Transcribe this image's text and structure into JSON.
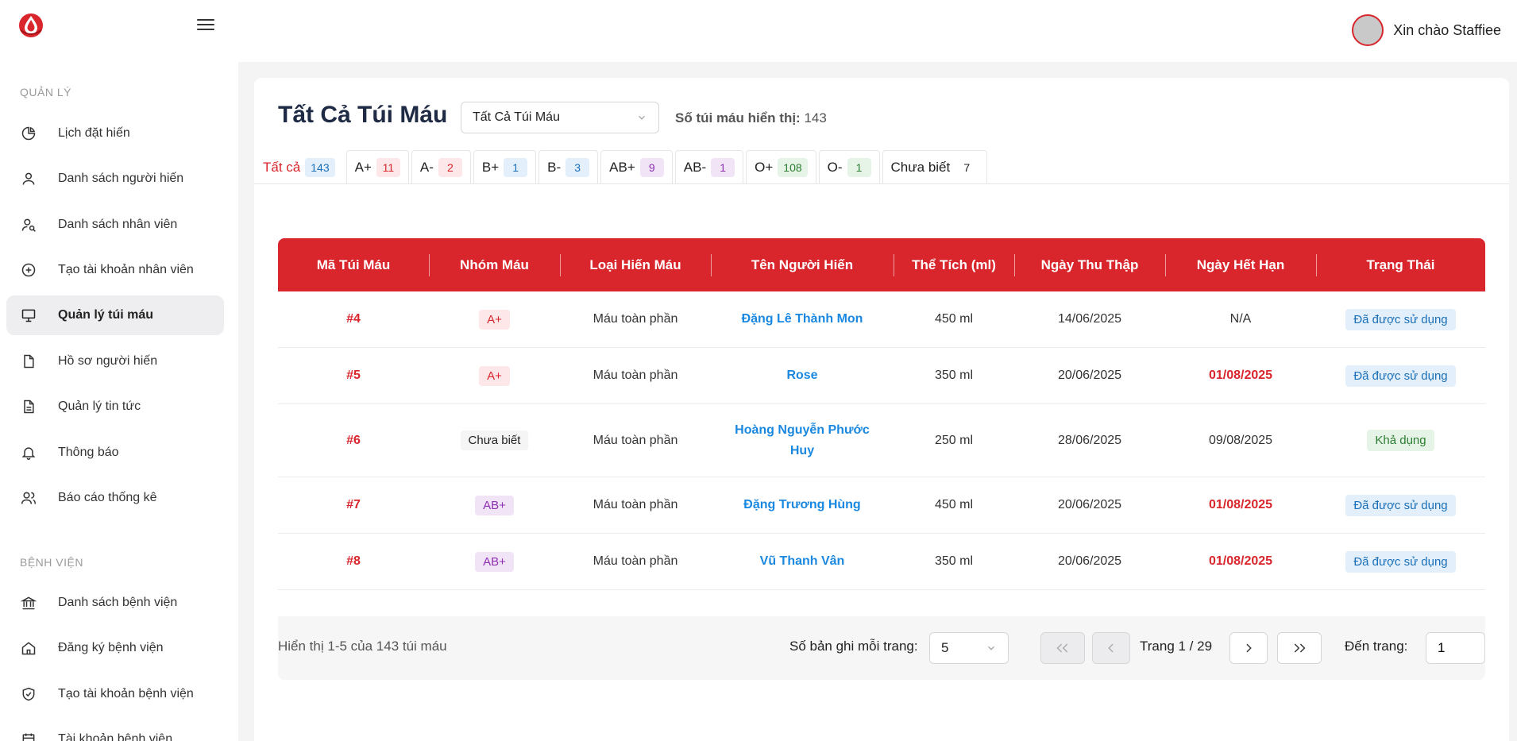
{
  "header": {
    "greeting": "Xin chào Staffiee"
  },
  "sidebar": {
    "section_manage": "QUẢN LÝ",
    "manage_items": [
      {
        "label": "Lịch đặt hiến",
        "icon": "pie-chart-icon"
      },
      {
        "label": "Danh sách người hiến",
        "icon": "user-icon"
      },
      {
        "label": "Danh sách nhân viên",
        "icon": "user-search-icon"
      },
      {
        "label": "Tạo tài khoản nhân viên",
        "icon": "plus-circle-icon"
      },
      {
        "label": "Quản lý túi máu",
        "icon": "monitor-icon",
        "active": true
      },
      {
        "label": "Hồ sơ người hiến",
        "icon": "file-icon"
      },
      {
        "label": "Quản lý tin tức",
        "icon": "file-text-icon"
      },
      {
        "label": "Thông báo",
        "icon": "bell-icon"
      },
      {
        "label": "Báo cáo thống kê",
        "icon": "users-icon"
      }
    ],
    "section_hospital": "BỆNH VIỆN",
    "hospital_items": [
      {
        "label": "Danh sách bệnh viện",
        "icon": "bank-icon"
      },
      {
        "label": "Đăng ký bệnh viện",
        "icon": "home-icon"
      },
      {
        "label": "Tạo tài khoản bệnh viện",
        "icon": "shield-check-icon"
      },
      {
        "label": "Tài khoản bệnh viện",
        "icon": "calendar-icon"
      }
    ]
  },
  "main": {
    "title": "Tất Cả Túi Máu",
    "filter_value": "Tất Cả Túi Máu",
    "count_label": "Số túi máu hiển thị:",
    "count_value": "143",
    "tabs": [
      {
        "label": "Tất cả",
        "count": "143",
        "bg": "#e3f0fb",
        "fg": "#1a6fb8"
      },
      {
        "label": "A+",
        "count": "11",
        "bg": "#fde7e8",
        "fg": "#d9262c"
      },
      {
        "label": "A-",
        "count": "2",
        "bg": "#fde7e8",
        "fg": "#d9262c"
      },
      {
        "label": "B+",
        "count": "1",
        "bg": "#e3f0fb",
        "fg": "#1a6fb8"
      },
      {
        "label": "B-",
        "count": "3",
        "bg": "#e3f0fb",
        "fg": "#1a6fb8"
      },
      {
        "label": "AB+",
        "count": "9",
        "bg": "#f1e4f7",
        "fg": "#8e2fb0"
      },
      {
        "label": "AB-",
        "count": "1",
        "bg": "#f1e4f7",
        "fg": "#8e2fb0"
      },
      {
        "label": "O+",
        "count": "108",
        "bg": "#e5f4e6",
        "fg": "#2e7d32"
      },
      {
        "label": "O-",
        "count": "1",
        "bg": "#e5f4e6",
        "fg": "#2e7d32"
      },
      {
        "label": "Chưa biết",
        "count": "7",
        "bg": "#ffffff",
        "fg": "#222222"
      }
    ],
    "table": {
      "headers": [
        "Mã Túi Máu",
        "Nhóm Máu",
        "Loại Hiến Máu",
        "Tên Người Hiến",
        "Thể Tích (ml)",
        "Ngày Thu Thập",
        "Ngày Hết Hạn",
        "Trạng Thái"
      ],
      "rows": [
        {
          "id": "#4",
          "group": "A+",
          "type": "Máu toàn phần",
          "donor": "Đặng Lê Thành Mon",
          "volume": "450 ml",
          "collected": "14/06/2025",
          "expiry": "N/A",
          "expired": false,
          "status": "Đã được sử dụng"
        },
        {
          "id": "#5",
          "group": "A+",
          "type": "Máu toàn phần",
          "donor": "Rose",
          "volume": "350 ml",
          "collected": "20/06/2025",
          "expiry": "01/08/2025",
          "expired": true,
          "status": "Đã được sử dụng"
        },
        {
          "id": "#6",
          "group": "Chưa biết",
          "type": "Máu toàn phần",
          "donor": "Hoàng Nguyễn Phước Huy",
          "volume": "250 ml",
          "collected": "28/06/2025",
          "expiry": "09/08/2025",
          "expired": false,
          "status": "Khả dụng"
        },
        {
          "id": "#7",
          "group": "AB+",
          "type": "Máu toàn phần",
          "donor": "Đặng Trương Hùng",
          "volume": "450 ml",
          "collected": "20/06/2025",
          "expiry": "01/08/2025",
          "expired": true,
          "status": "Đã được sử dụng"
        },
        {
          "id": "#8",
          "group": "AB+",
          "type": "Máu toàn phần",
          "donor": "Vũ Thanh Vân",
          "volume": "350 ml",
          "collected": "20/06/2025",
          "expiry": "01/08/2025",
          "expired": true,
          "status": "Đã được sử dụng"
        }
      ]
    },
    "footer": {
      "info": "Hiển thị 1-5 của 143 túi máu",
      "per_page_label": "Số bản ghi mỗi trang:",
      "per_page_value": "5",
      "page_text": "Trang 1 / 29",
      "goto_label": "Đến trang:",
      "goto_value": "1"
    }
  },
  "colors": {
    "brand_red": "#d9262c",
    "link_blue": "#1a88e0"
  }
}
